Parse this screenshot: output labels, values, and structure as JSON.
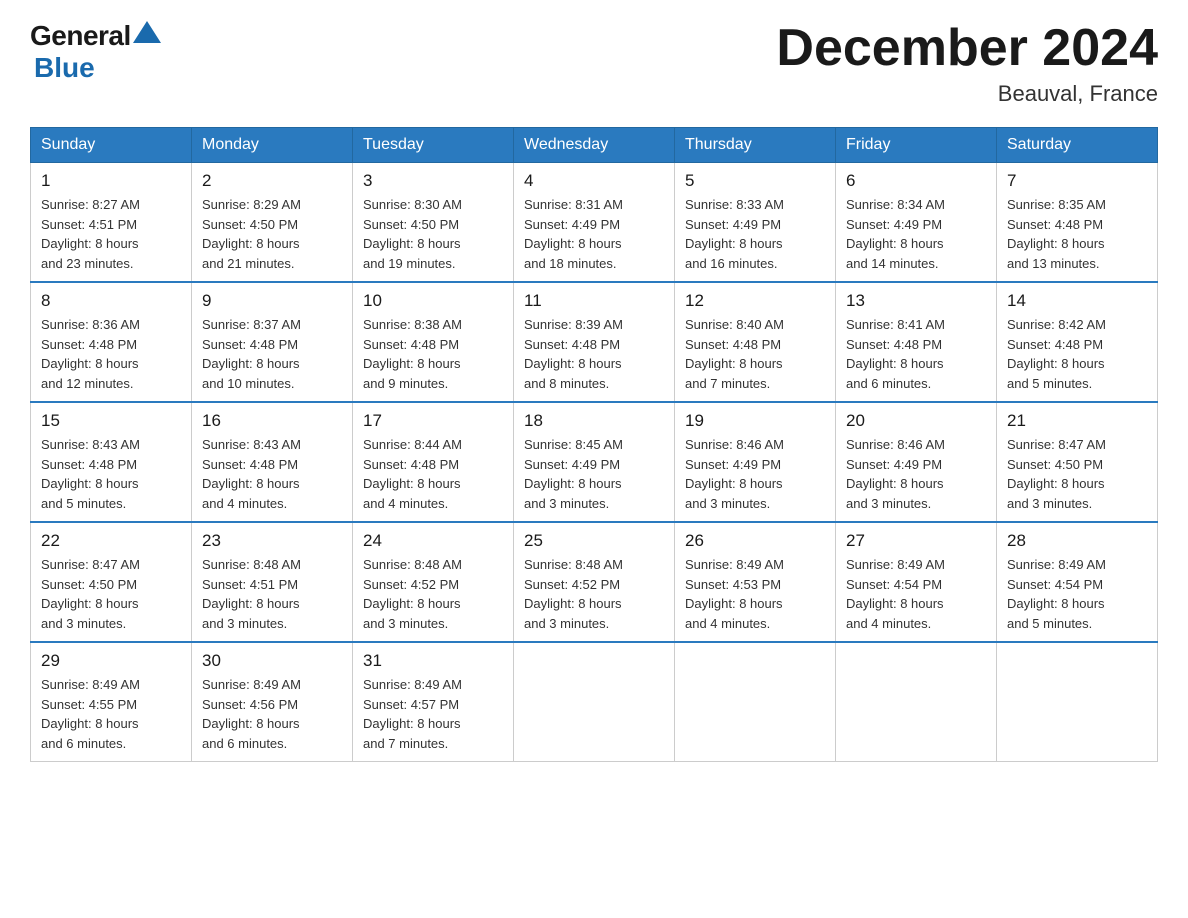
{
  "header": {
    "logo_general": "General",
    "logo_blue": "Blue",
    "title": "December 2024",
    "location": "Beauval, France"
  },
  "days_of_week": [
    "Sunday",
    "Monday",
    "Tuesday",
    "Wednesday",
    "Thursday",
    "Friday",
    "Saturday"
  ],
  "weeks": [
    [
      {
        "day": "1",
        "sunrise": "8:27 AM",
        "sunset": "4:51 PM",
        "daylight": "8 hours and 23 minutes."
      },
      {
        "day": "2",
        "sunrise": "8:29 AM",
        "sunset": "4:50 PM",
        "daylight": "8 hours and 21 minutes."
      },
      {
        "day": "3",
        "sunrise": "8:30 AM",
        "sunset": "4:50 PM",
        "daylight": "8 hours and 19 minutes."
      },
      {
        "day": "4",
        "sunrise": "8:31 AM",
        "sunset": "4:49 PM",
        "daylight": "8 hours and 18 minutes."
      },
      {
        "day": "5",
        "sunrise": "8:33 AM",
        "sunset": "4:49 PM",
        "daylight": "8 hours and 16 minutes."
      },
      {
        "day": "6",
        "sunrise": "8:34 AM",
        "sunset": "4:49 PM",
        "daylight": "8 hours and 14 minutes."
      },
      {
        "day": "7",
        "sunrise": "8:35 AM",
        "sunset": "4:48 PM",
        "daylight": "8 hours and 13 minutes."
      }
    ],
    [
      {
        "day": "8",
        "sunrise": "8:36 AM",
        "sunset": "4:48 PM",
        "daylight": "8 hours and 12 minutes."
      },
      {
        "day": "9",
        "sunrise": "8:37 AM",
        "sunset": "4:48 PM",
        "daylight": "8 hours and 10 minutes."
      },
      {
        "day": "10",
        "sunrise": "8:38 AM",
        "sunset": "4:48 PM",
        "daylight": "8 hours and 9 minutes."
      },
      {
        "day": "11",
        "sunrise": "8:39 AM",
        "sunset": "4:48 PM",
        "daylight": "8 hours and 8 minutes."
      },
      {
        "day": "12",
        "sunrise": "8:40 AM",
        "sunset": "4:48 PM",
        "daylight": "8 hours and 7 minutes."
      },
      {
        "day": "13",
        "sunrise": "8:41 AM",
        "sunset": "4:48 PM",
        "daylight": "8 hours and 6 minutes."
      },
      {
        "day": "14",
        "sunrise": "8:42 AM",
        "sunset": "4:48 PM",
        "daylight": "8 hours and 5 minutes."
      }
    ],
    [
      {
        "day": "15",
        "sunrise": "8:43 AM",
        "sunset": "4:48 PM",
        "daylight": "8 hours and 5 minutes."
      },
      {
        "day": "16",
        "sunrise": "8:43 AM",
        "sunset": "4:48 PM",
        "daylight": "8 hours and 4 minutes."
      },
      {
        "day": "17",
        "sunrise": "8:44 AM",
        "sunset": "4:48 PM",
        "daylight": "8 hours and 4 minutes."
      },
      {
        "day": "18",
        "sunrise": "8:45 AM",
        "sunset": "4:49 PM",
        "daylight": "8 hours and 3 minutes."
      },
      {
        "day": "19",
        "sunrise": "8:46 AM",
        "sunset": "4:49 PM",
        "daylight": "8 hours and 3 minutes."
      },
      {
        "day": "20",
        "sunrise": "8:46 AM",
        "sunset": "4:49 PM",
        "daylight": "8 hours and 3 minutes."
      },
      {
        "day": "21",
        "sunrise": "8:47 AM",
        "sunset": "4:50 PM",
        "daylight": "8 hours and 3 minutes."
      }
    ],
    [
      {
        "day": "22",
        "sunrise": "8:47 AM",
        "sunset": "4:50 PM",
        "daylight": "8 hours and 3 minutes."
      },
      {
        "day": "23",
        "sunrise": "8:48 AM",
        "sunset": "4:51 PM",
        "daylight": "8 hours and 3 minutes."
      },
      {
        "day": "24",
        "sunrise": "8:48 AM",
        "sunset": "4:52 PM",
        "daylight": "8 hours and 3 minutes."
      },
      {
        "day": "25",
        "sunrise": "8:48 AM",
        "sunset": "4:52 PM",
        "daylight": "8 hours and 3 minutes."
      },
      {
        "day": "26",
        "sunrise": "8:49 AM",
        "sunset": "4:53 PM",
        "daylight": "8 hours and 4 minutes."
      },
      {
        "day": "27",
        "sunrise": "8:49 AM",
        "sunset": "4:54 PM",
        "daylight": "8 hours and 4 minutes."
      },
      {
        "day": "28",
        "sunrise": "8:49 AM",
        "sunset": "4:54 PM",
        "daylight": "8 hours and 5 minutes."
      }
    ],
    [
      {
        "day": "29",
        "sunrise": "8:49 AM",
        "sunset": "4:55 PM",
        "daylight": "8 hours and 6 minutes."
      },
      {
        "day": "30",
        "sunrise": "8:49 AM",
        "sunset": "4:56 PM",
        "daylight": "8 hours and 6 minutes."
      },
      {
        "day": "31",
        "sunrise": "8:49 AM",
        "sunset": "4:57 PM",
        "daylight": "8 hours and 7 minutes."
      },
      null,
      null,
      null,
      null
    ]
  ],
  "labels": {
    "sunrise": "Sunrise:",
    "sunset": "Sunset:",
    "daylight": "Daylight:"
  }
}
